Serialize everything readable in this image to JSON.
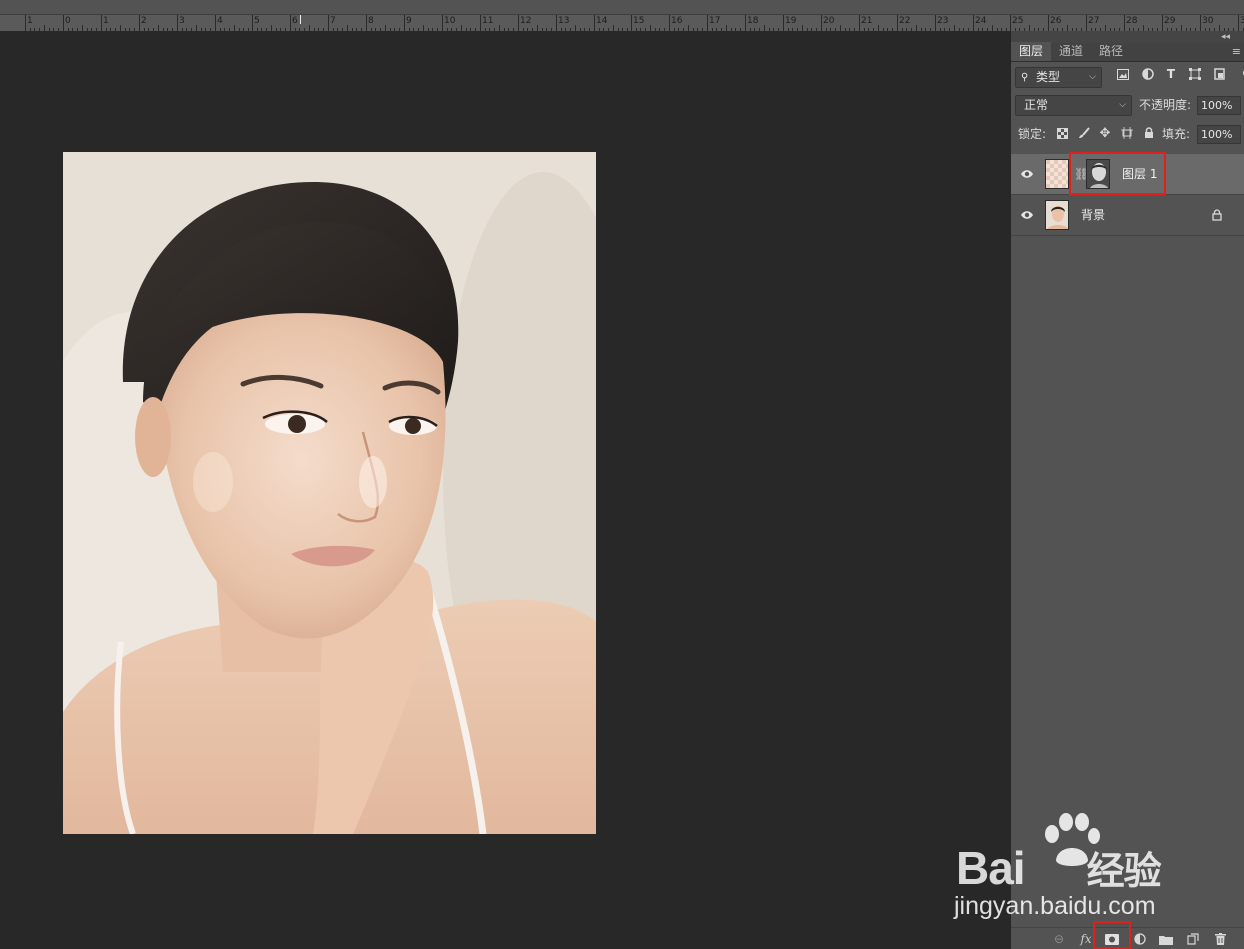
{
  "ruler": {
    "numbers": [
      "1",
      "0",
      "1",
      "2",
      "3",
      "4",
      "5",
      "6",
      "7",
      "8",
      "9",
      "10",
      "11",
      "12",
      "13",
      "14",
      "15",
      "16",
      "17",
      "18",
      "19",
      "20",
      "21",
      "22",
      "23",
      "24",
      "25",
      "26",
      "27",
      "28",
      "29",
      "30",
      "31"
    ]
  },
  "panel": {
    "tabs": [
      {
        "label": "图层",
        "active": true
      },
      {
        "label": "通道",
        "active": false
      },
      {
        "label": "路径",
        "active": false
      }
    ],
    "filter": {
      "label": "类型"
    },
    "blend": {
      "mode": "正常",
      "opacity_label": "不透明度:",
      "opacity_value": "100%"
    },
    "lock": {
      "label": "锁定:",
      "fill_label": "填充:",
      "fill_value": "100%"
    },
    "layers": [
      {
        "name": "图层 1",
        "selected": true,
        "has_mask": true
      },
      {
        "name": "背景",
        "selected": false,
        "locked": true
      }
    ]
  },
  "watermark": {
    "line1": "Bai",
    "line1b": "经验",
    "line2": "jingyan.baidu.com"
  },
  "colors": {
    "highlight": "#e0201c",
    "panel": "#535353",
    "canvas": "#282828"
  }
}
